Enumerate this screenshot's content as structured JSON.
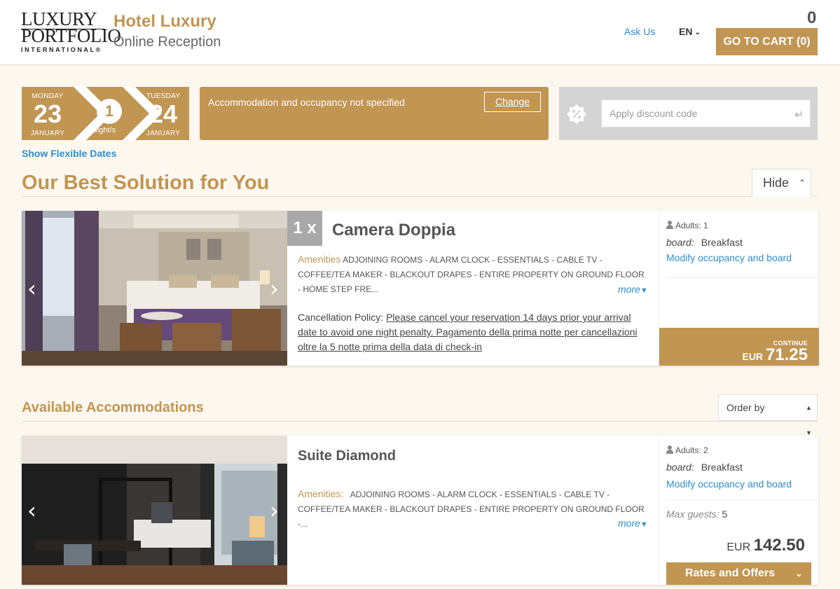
{
  "header": {
    "logo": {
      "line1": "LUXURY",
      "line2": "PORTFOLIO",
      "line3": "INTERNATIONAL®"
    },
    "hotel_name": "Hotel Luxury",
    "subtitle": "Online Reception",
    "ask_us": "Ask Us",
    "language": "EN",
    "cart_count": "0",
    "cart_button": "GO TO CART (0)"
  },
  "stay": {
    "checkin": {
      "weekday": "MONDAY",
      "day": "23",
      "month": "JANUARY"
    },
    "checkout": {
      "weekday": "TUESDAY",
      "day": "24",
      "month": "JANUARY"
    },
    "nights": "1",
    "nights_label": "Night/s",
    "flexible_dates": "Show Flexible Dates"
  },
  "occupancy_box": {
    "message": "Accommodation and occupancy not specified",
    "change_label": "Change"
  },
  "discount": {
    "placeholder": "Apply discount code"
  },
  "best_solution": {
    "title": "Our Best Solution for You",
    "hide_label": "Hide",
    "quantity": "1 x",
    "room_name": "Camera Doppia",
    "amenities_label": "Amenities",
    "amenities": "ADJOINING ROOMS - ALARM CLOCK - ESSENTIALS - CABLE TV - COFFEE/TEA MAKER - BLACKOUT DRAPES - ENTIRE PROPERTY ON GROUND FLOOR - HOME STEP FRE...",
    "more": "more",
    "cancellation_label": "Cancellation Policy",
    "cancellation_text": "Please cancel your reservation 14 days prior your arrival date to avoid one night penalty. Pagamento della prima notte per cancellazioni oltre la 5 notte prima della data di check-in",
    "adults_label": "Adults:",
    "adults": "1",
    "board_label": "board:",
    "board": "Breakfast",
    "modify": "Modify occupancy and board",
    "continue_label": "CONTINUE",
    "currency": "EUR",
    "price": "71.25"
  },
  "available": {
    "title": "Available Accommodations",
    "order_by": "Order by",
    "rooms": [
      {
        "name": "Suite Diamond",
        "amenities_label": "Amenities:",
        "amenities": "ADJOINING ROOMS - ALARM CLOCK - ESSENTIALS - CABLE TV - COFFEE/TEA MAKER - BLACKOUT DRAPES - ENTIRE PROPERTY ON GROUND FLOOR -...",
        "more": "more",
        "adults_label": "Adults:",
        "adults": "2",
        "board_label": "board:",
        "board": "Breakfast",
        "modify": "Modify occupancy and board",
        "max_guests_label": "Max guests:",
        "max_guests": "5",
        "currency": "EUR",
        "price": "142.50",
        "rates_button": "Rates and Offers"
      }
    ]
  },
  "colors": {
    "accent": "#c19552",
    "link": "#2b8fd6",
    "background": "#fdf8ef"
  }
}
